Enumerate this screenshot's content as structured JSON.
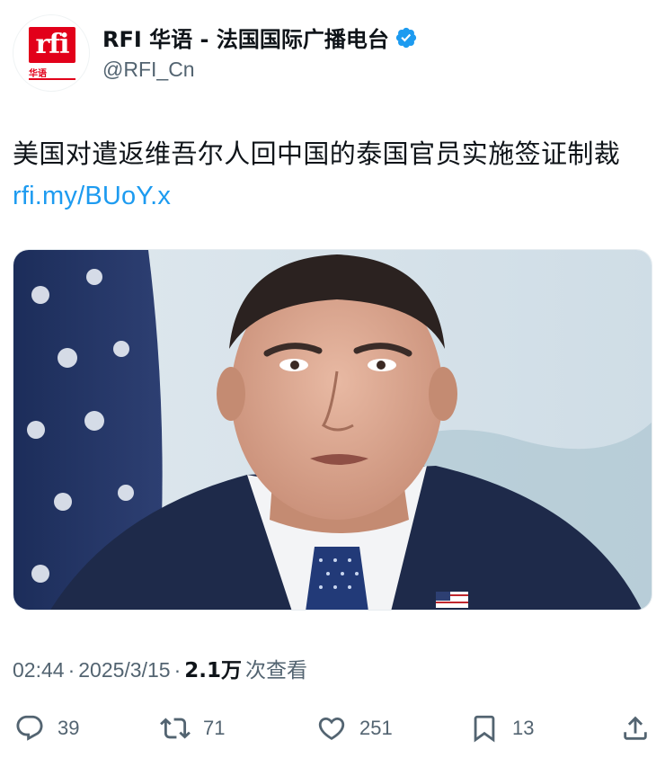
{
  "account": {
    "display_name": "RFI 华语 - 法国国际广播电台",
    "handle": "@RFI_Cn",
    "verified": true,
    "avatar_logo_text": "rfi",
    "avatar_logo_sub": "华语",
    "brand_color": "#e2001a",
    "verified_color": "#1d9bf0"
  },
  "tweet": {
    "text": "美国对遣返维吾尔人回中国的泰国官员实施签证制裁",
    "link": "rfi.my/BUoY.x",
    "link_color": "#1d9bf0",
    "media_alt": "photo"
  },
  "meta": {
    "time": "02:44",
    "separator": "·",
    "date": "2025/3/15",
    "views_count": "2.1万",
    "views_label": "次查看"
  },
  "actions": {
    "reply_count": "39",
    "retweet_count": "71",
    "like_count": "251",
    "bookmark_count": "13",
    "icons": [
      "reply-icon",
      "retweet-icon",
      "like-icon",
      "bookmark-icon",
      "share-icon"
    ]
  }
}
